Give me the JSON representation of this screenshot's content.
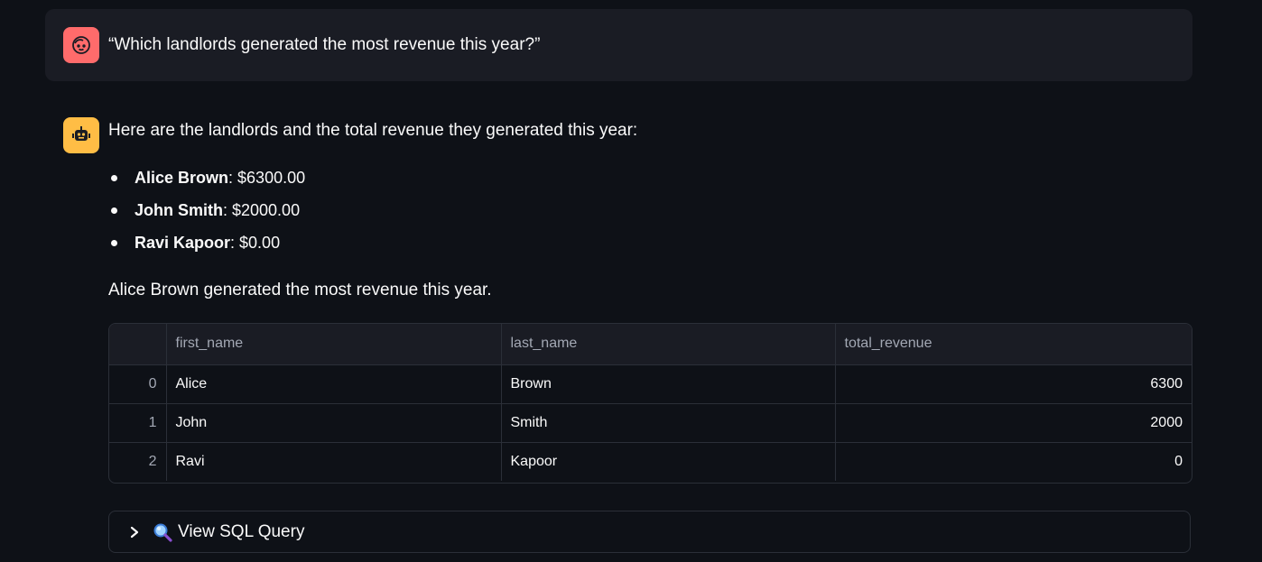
{
  "user_message": {
    "text": "“Which landlords generated the most revenue this year?”",
    "avatar_icon": "user-face-icon",
    "avatar_color": "#ff6b6b"
  },
  "assistant_message": {
    "avatar_icon": "robot-icon",
    "avatar_color": "#ffbd45",
    "intro": "Here are the landlords and the total revenue they generated this year:",
    "bullets": [
      {
        "name": "Alice Brown",
        "value": ": $6300.00"
      },
      {
        "name": "John Smith",
        "value": ": $2000.00"
      },
      {
        "name": "Ravi Kapoor",
        "value": ": $0.00"
      }
    ],
    "conclusion": "Alice Brown generated the most revenue this year."
  },
  "table": {
    "columns": [
      "",
      "first_name",
      "last_name",
      "total_revenue"
    ],
    "rows": [
      [
        "0",
        "Alice",
        "Brown",
        "6300"
      ],
      [
        "1",
        "John",
        "Smith",
        "2000"
      ],
      [
        "2",
        "Ravi",
        "Kapoor",
        "0"
      ]
    ]
  },
  "expander": {
    "label": "View SQL Query",
    "icon": "magnifying-glass-icon",
    "expanded": false
  }
}
